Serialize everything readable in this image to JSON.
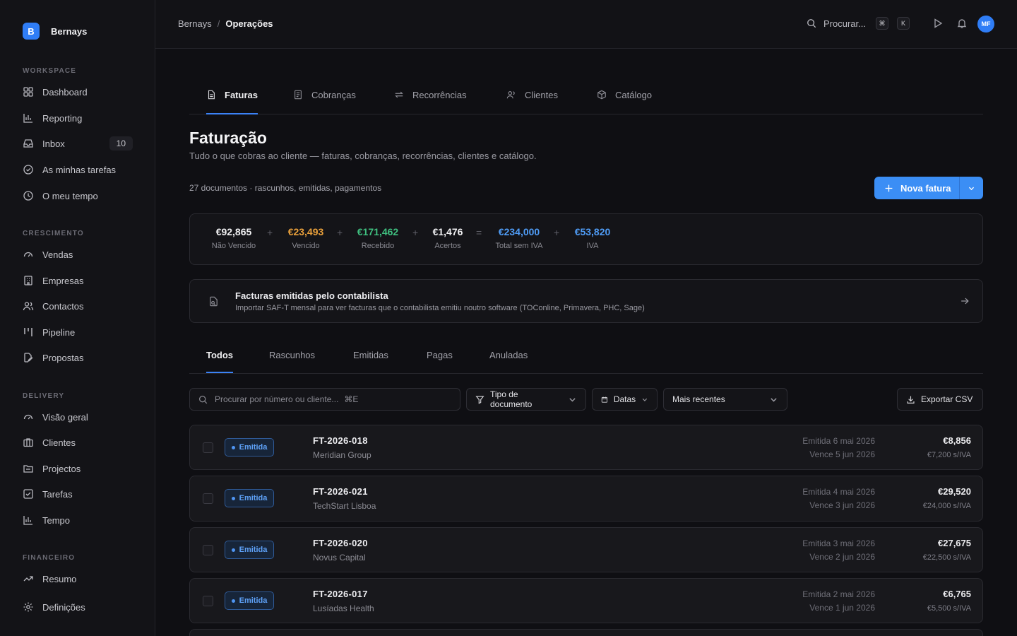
{
  "brand": {
    "initial": "B",
    "name": "Bernays"
  },
  "sidebar": {
    "sections": [
      {
        "label": "WORKSPACE"
      },
      {
        "label": "CRESCIMENTO"
      },
      {
        "label": "DELIVERY"
      },
      {
        "label": "FINANCEIRO"
      }
    ],
    "items": [
      {
        "label": "Dashboard",
        "icon": "grid-icon"
      },
      {
        "label": "Reporting",
        "icon": "bar-chart-icon"
      },
      {
        "label": "Inbox",
        "icon": "inbox-icon",
        "badge": "10"
      },
      {
        "label": "As minhas tarefas",
        "icon": "check-circle-icon"
      },
      {
        "label": "O meu tempo",
        "icon": "clock-icon"
      },
      {
        "label": "Vendas",
        "icon": "gauge-icon"
      },
      {
        "label": "Empresas",
        "icon": "building-icon"
      },
      {
        "label": "Contactos",
        "icon": "users-icon"
      },
      {
        "label": "Pipeline",
        "icon": "pipeline-icon"
      },
      {
        "label": "Propostas",
        "icon": "file-edit-icon"
      },
      {
        "label": "Visão geral",
        "icon": "gauge-icon"
      },
      {
        "label": "Clientes",
        "icon": "briefcase-icon"
      },
      {
        "label": "Projectos",
        "icon": "folder-icon"
      },
      {
        "label": "Tarefas",
        "icon": "check-square-icon"
      },
      {
        "label": "Tempo",
        "icon": "bar-chart-icon"
      },
      {
        "label": "Resumo",
        "icon": "trend-icon"
      },
      {
        "label": "Definições",
        "icon": "gear-icon"
      }
    ]
  },
  "topbar": {
    "breadcrumb": [
      "Bernays",
      "Operações"
    ],
    "separator": "/",
    "search_label": "Procurar...",
    "shortcut": [
      "⌘",
      "K"
    ],
    "avatar_initials": "MF"
  },
  "tabs_top": [
    {
      "label": "Faturas",
      "active": true
    },
    {
      "label": "Cobranças"
    },
    {
      "label": "Recorrências"
    },
    {
      "label": "Clientes"
    },
    {
      "label": "Catálogo"
    }
  ],
  "page": {
    "title": "Faturação",
    "subtitle": "Tudo o que cobras ao cliente — faturas, cobranças, recorrências, clientes e catálogo.",
    "doc_count": "27 documentos · rascunhos, emitidas, pagamentos",
    "new_button": "Nova fatura"
  },
  "summary": {
    "items": [
      {
        "value": "€92,865",
        "label": "Não Vencido",
        "color": "#f0f0f2"
      },
      {
        "value": "€23,493",
        "label": "Vencido",
        "color": "#e9a03b"
      },
      {
        "value": "€171,462",
        "label": "Recebido",
        "color": "#3fbf7f"
      },
      {
        "value": "€1,476",
        "label": "Acertos",
        "color": "#f0f0f2"
      },
      {
        "value": "€234,000",
        "label": "Total sem IVA",
        "color": "#4f9cf6"
      },
      {
        "value": "€53,820",
        "label": "IVA",
        "color": "#4f9cf6"
      }
    ],
    "operators": [
      "+",
      "+",
      "+",
      "=",
      "+"
    ]
  },
  "banner": {
    "title": "Facturas emitidas pelo contabilista",
    "subtitle": "Importar SAF-T mensal para ver facturas que o contabilista emitiu noutro software (TOConline, Primavera, PHC, Sage)"
  },
  "tabs_mid": [
    {
      "label": "Todos",
      "active": true
    },
    {
      "label": "Rascunhos"
    },
    {
      "label": "Emitidas"
    },
    {
      "label": "Pagas"
    },
    {
      "label": "Anuladas"
    }
  ],
  "filters": {
    "search_placeholder": "Procurar por número ou cliente...",
    "search_shortcut": "⌘E",
    "doc_type": "Tipo de documento",
    "dates": "Datas",
    "sort": "Mais recentes",
    "export": "Exportar CSV"
  },
  "invoices": [
    {
      "status": "Emitida",
      "number": "FT-2026-018",
      "client": "Meridian Group",
      "issued": "Emitida 6 mai 2026",
      "due": "Vence 5 jun 2026",
      "amount": "€8,856",
      "net": "€7,200 s/IVA"
    },
    {
      "status": "Emitida",
      "number": "FT-2026-021",
      "client": "TechStart Lisboa",
      "issued": "Emitida 4 mai 2026",
      "due": "Vence 3 jun 2026",
      "amount": "€29,520",
      "net": "€24,000 s/IVA"
    },
    {
      "status": "Emitida",
      "number": "FT-2026-020",
      "client": "Novus Capital",
      "issued": "Emitida 3 mai 2026",
      "due": "Vence 2 jun 2026",
      "amount": "€27,675",
      "net": "€22,500 s/IVA"
    },
    {
      "status": "Emitida",
      "number": "FT-2026-017",
      "client": "Lusíadas Health",
      "issued": "Emitida 2 mai 2026",
      "due": "Vence 1 jun 2026",
      "amount": "€6,765",
      "net": "€5,500 s/IVA"
    }
  ]
}
